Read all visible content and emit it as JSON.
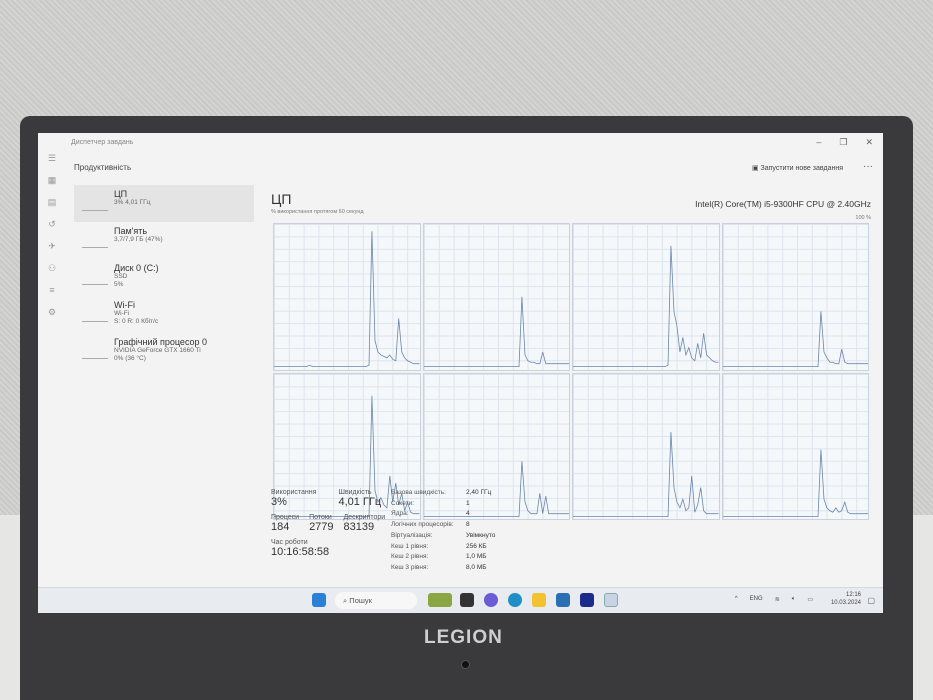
{
  "window": {
    "title": "Диспетчер завдань",
    "section": "Продуктивність",
    "new_task": "Запустити нове завдання",
    "more": "···",
    "minimize": "–",
    "restore": "❐",
    "close": "✕"
  },
  "sidebar": [
    {
      "title": "ЦП",
      "line1": "3% 4,01 ГГц",
      "line2": ""
    },
    {
      "title": "Пам'ять",
      "line1": "3,7/7,9 ГБ (47%)",
      "line2": ""
    },
    {
      "title": "Диск 0 (C:)",
      "line1": "SSD",
      "line2": "5%"
    },
    {
      "title": "Wi-Fi",
      "line1": "Wi-Fi",
      "line2": "S: 0 R: 0 Кбіт/с"
    },
    {
      "title": "Графічний процесор 0",
      "line1": "NVIDIA GeForce GTX 1660 Ti",
      "line2": "0% (36 °C)"
    }
  ],
  "main": {
    "title": "ЦП",
    "cpu_name": "Intel(R) Core(TM) i5-9300HF CPU @ 2.40GHz",
    "subtitle": "% використання протягом 60 секунд",
    "max_label": "100 %"
  },
  "cpu_graphs": [
    [
      2,
      2,
      2,
      2,
      2,
      2,
      2,
      2,
      2,
      2,
      2,
      2,
      3,
      2,
      2,
      2,
      2,
      2,
      2,
      2,
      2,
      2,
      2,
      2,
      2,
      2,
      2,
      2,
      2,
      2,
      2,
      2,
      3,
      95,
      20,
      12,
      10,
      9,
      8,
      10,
      7,
      6,
      35,
      12,
      8,
      6,
      5,
      4,
      4,
      4
    ],
    [
      2,
      2,
      2,
      2,
      2,
      2,
      2,
      2,
      2,
      2,
      2,
      2,
      2,
      2,
      2,
      2,
      2,
      2,
      2,
      2,
      2,
      2,
      2,
      2,
      2,
      2,
      2,
      2,
      2,
      2,
      2,
      2,
      2,
      50,
      10,
      6,
      5,
      5,
      4,
      4,
      12,
      4,
      4,
      4,
      4,
      4,
      4,
      4,
      4,
      4
    ],
    [
      2,
      2,
      2,
      2,
      2,
      2,
      2,
      2,
      2,
      2,
      2,
      2,
      2,
      2,
      2,
      2,
      2,
      2,
      2,
      2,
      2,
      2,
      2,
      2,
      2,
      2,
      2,
      2,
      2,
      2,
      2,
      2,
      3,
      85,
      40,
      30,
      12,
      22,
      10,
      15,
      8,
      6,
      18,
      8,
      25,
      10,
      8,
      6,
      5,
      5
    ],
    [
      2,
      2,
      2,
      2,
      2,
      2,
      2,
      2,
      2,
      2,
      2,
      2,
      2,
      2,
      2,
      2,
      2,
      2,
      2,
      2,
      2,
      2,
      2,
      2,
      2,
      2,
      2,
      2,
      2,
      2,
      2,
      2,
      2,
      40,
      12,
      8,
      5,
      5,
      4,
      4,
      14,
      5,
      4,
      4,
      4,
      4,
      4,
      4,
      4,
      4
    ],
    [
      2,
      2,
      2,
      2,
      2,
      2,
      2,
      2,
      2,
      2,
      2,
      2,
      2,
      2,
      2,
      2,
      2,
      2,
      2,
      2,
      2,
      2,
      2,
      2,
      2,
      2,
      2,
      2,
      2,
      2,
      2,
      2,
      2,
      85,
      20,
      12,
      15,
      10,
      8,
      30,
      12,
      25,
      10,
      18,
      6,
      12,
      5,
      4,
      4,
      4
    ],
    [
      2,
      2,
      2,
      2,
      2,
      2,
      2,
      2,
      2,
      2,
      2,
      2,
      2,
      2,
      2,
      2,
      2,
      2,
      2,
      2,
      2,
      2,
      2,
      2,
      2,
      2,
      2,
      2,
      2,
      2,
      2,
      2,
      2,
      40,
      12,
      6,
      4,
      4,
      4,
      18,
      4,
      16,
      4,
      4,
      4,
      4,
      4,
      4,
      4,
      4
    ],
    [
      2,
      2,
      2,
      2,
      2,
      2,
      2,
      2,
      2,
      2,
      2,
      2,
      2,
      2,
      2,
      2,
      2,
      2,
      2,
      2,
      2,
      2,
      2,
      2,
      2,
      2,
      2,
      2,
      2,
      2,
      2,
      2,
      2,
      60,
      22,
      12,
      8,
      14,
      6,
      8,
      30,
      5,
      10,
      22,
      6,
      4,
      4,
      4,
      4,
      4
    ],
    [
      2,
      2,
      2,
      2,
      2,
      2,
      2,
      2,
      2,
      2,
      2,
      2,
      2,
      2,
      2,
      2,
      2,
      2,
      2,
      2,
      2,
      2,
      2,
      2,
      2,
      2,
      2,
      2,
      2,
      2,
      2,
      2,
      2,
      48,
      14,
      8,
      6,
      5,
      8,
      5,
      6,
      12,
      5,
      4,
      4,
      4,
      4,
      4,
      4,
      4
    ]
  ],
  "stats": {
    "usage_label": "Використання",
    "usage": "3%",
    "speed_label": "Швидкість",
    "speed": "4,01 ГГц",
    "proc_label": "Процеси",
    "proc": "184",
    "threads_label": "Потоки",
    "threads": "2779",
    "handles_label": "Дескриптори",
    "handles": "83139",
    "uptime_label": "Час роботи",
    "uptime": "10:16:58:58"
  },
  "props": [
    {
      "k": "Базова швидкість:",
      "v": "2,40 ГГц"
    },
    {
      "k": "Сокети:",
      "v": "1"
    },
    {
      "k": "Ядра:",
      "v": "4"
    },
    {
      "k": "Логічних процесорів:",
      "v": "8"
    },
    {
      "k": "Віртуалізація:",
      "v": "Увімкнуто"
    },
    {
      "k": "Кеш 1 рівня:",
      "v": "256 КБ"
    },
    {
      "k": "Кеш 2 рівня:",
      "v": "1,0 МБ"
    },
    {
      "k": "Кеш 3 рівня:",
      "v": "8,0 МБ"
    }
  ],
  "taskbar": {
    "search": "Пошук",
    "lang": "ENG",
    "time": "12:16",
    "date": "10.03.2024",
    "chevron": "^"
  },
  "brand": "LEGION",
  "colors": {
    "graph_line": "#6b86aa",
    "accent": "#0067c0"
  }
}
